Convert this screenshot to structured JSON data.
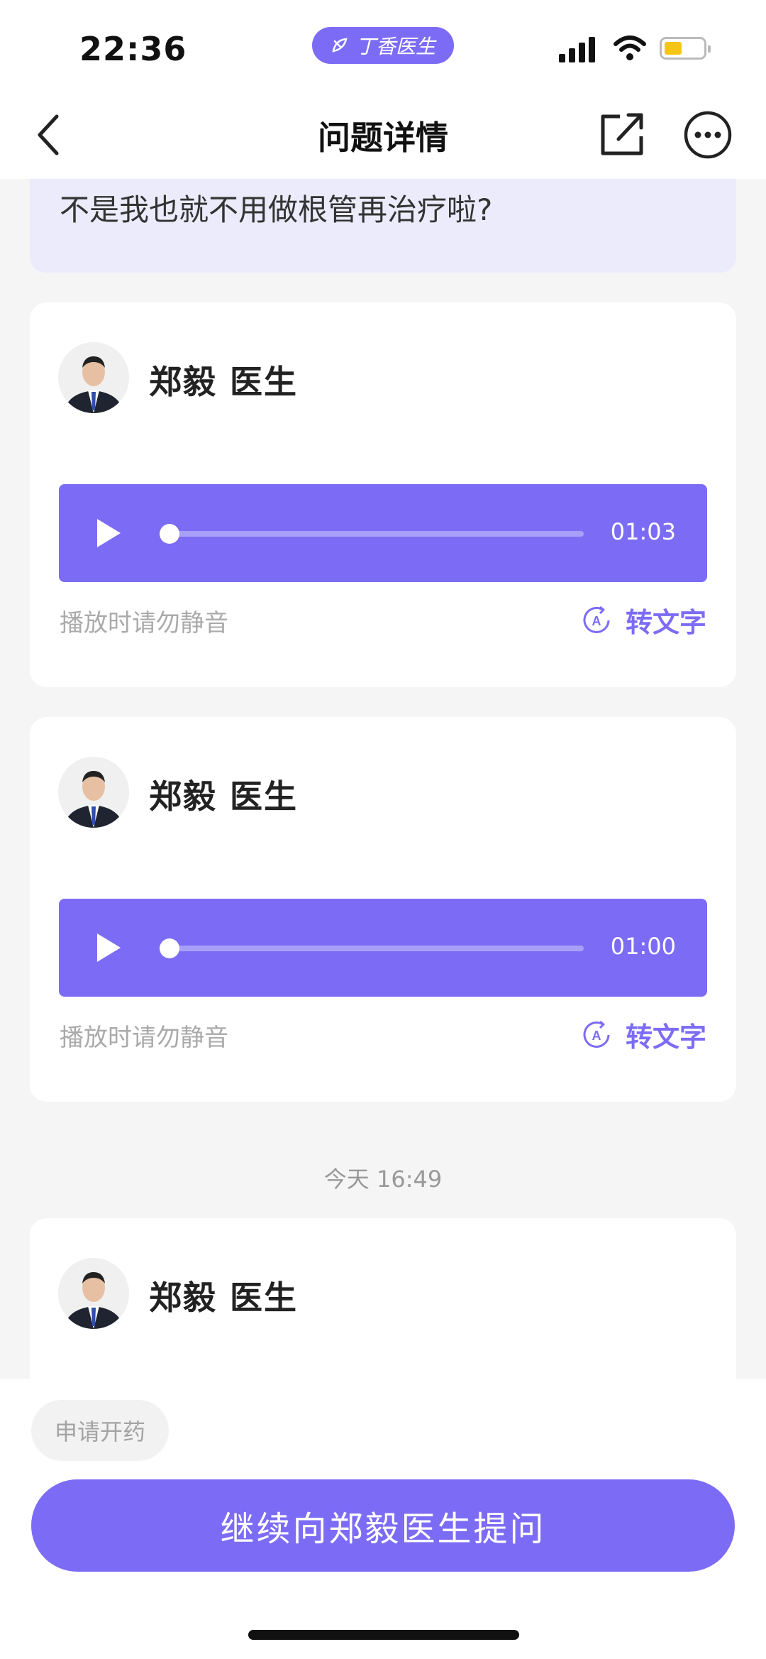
{
  "status_bar": {
    "time": "22:36",
    "app_pill": "丁香医生"
  },
  "nav": {
    "title": "问题详情",
    "icons": [
      "back-icon",
      "share-icon",
      "more-icon"
    ]
  },
  "question": {
    "text": "不是我也就不用做根管再治疗啦?"
  },
  "messages": [
    {
      "doctor": "郑毅 医生",
      "duration": "01:03",
      "hint": "播放时请勿静音",
      "to_text": "转文字",
      "progress": 0
    },
    {
      "doctor": "郑毅 医生",
      "duration": "01:00",
      "hint": "播放时请勿静音",
      "to_text": "转文字",
      "progress": 0
    },
    {
      "doctor": "郑毅 医生"
    }
  ],
  "timestamp": "今天 16:49",
  "bottom": {
    "prescription_button": "申请开药",
    "ask_button": "继续向郑毅医生提问"
  },
  "colors": {
    "accent": "#7c6cf5",
    "question_bg": "#ebebfb",
    "page_bg": "#f5f5f5"
  }
}
